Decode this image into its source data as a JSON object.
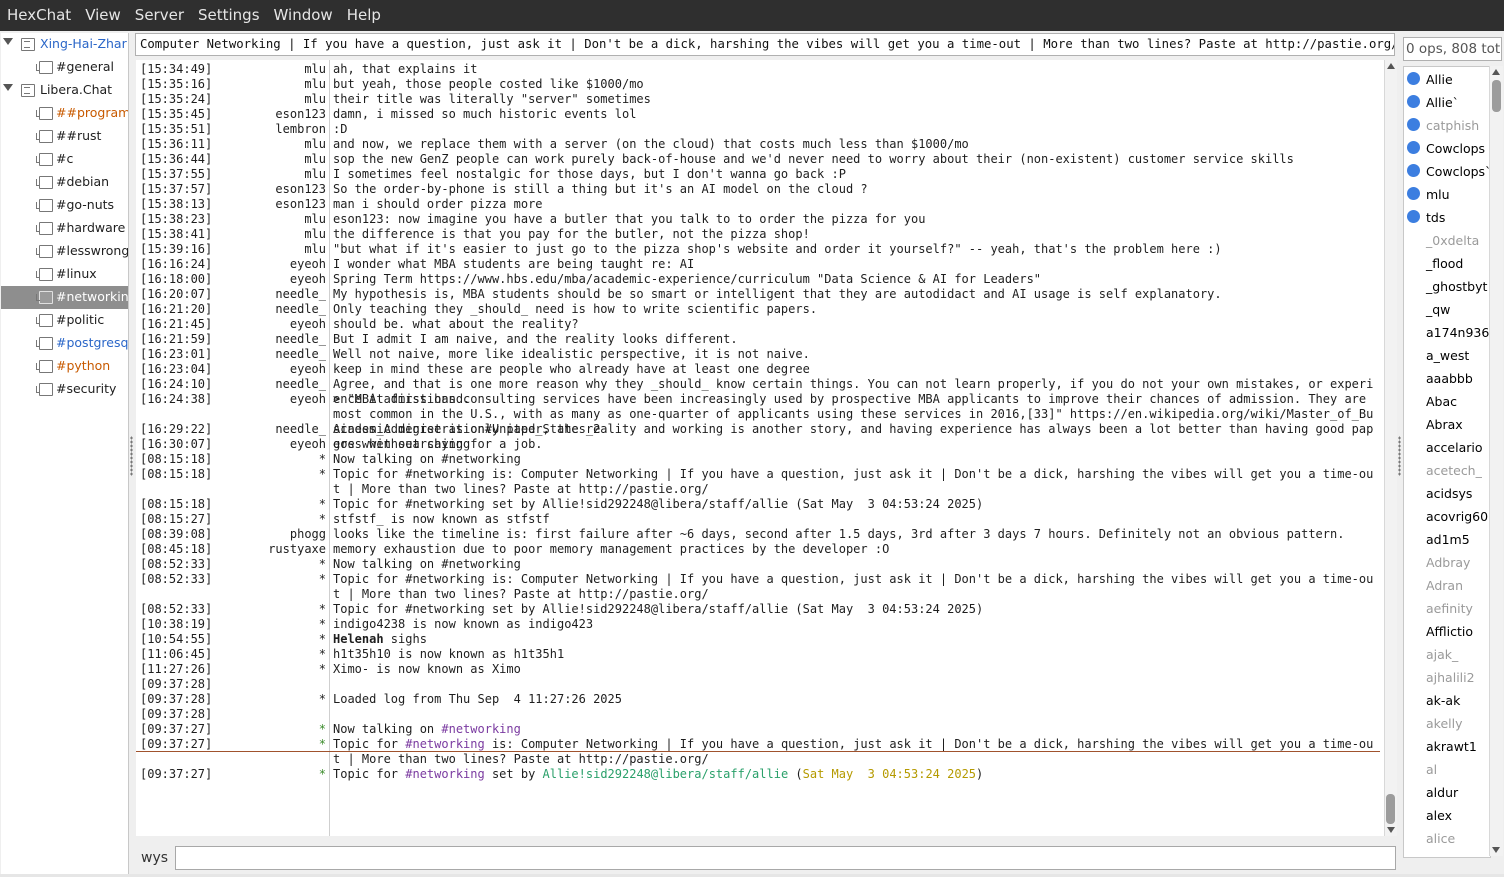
{
  "menu": [
    "HexChat",
    "View",
    "Server",
    "Settings",
    "Window",
    "Help"
  ],
  "tree": [
    {
      "label": "Xing-Hai-Zhar",
      "kind": "server",
      "style": "highlight"
    },
    {
      "label": "#general",
      "kind": "channel",
      "style": "normal"
    },
    {
      "label": "Libera.Chat",
      "kind": "server",
      "style": "normal"
    },
    {
      "label": "##programm",
      "kind": "channel",
      "style": "new-msg"
    },
    {
      "label": "##rust",
      "kind": "channel",
      "style": "normal"
    },
    {
      "label": "#c",
      "kind": "channel",
      "style": "normal"
    },
    {
      "label": "#debian",
      "kind": "channel",
      "style": "normal"
    },
    {
      "label": "#go-nuts",
      "kind": "channel",
      "style": "normal"
    },
    {
      "label": "#hardware",
      "kind": "channel",
      "style": "normal"
    },
    {
      "label": "#lesswrong",
      "kind": "channel",
      "style": "normal"
    },
    {
      "label": "#linux",
      "kind": "channel",
      "style": "normal"
    },
    {
      "label": "#networking",
      "kind": "channel",
      "style": "selected"
    },
    {
      "label": "#politic",
      "kind": "channel",
      "style": "normal"
    },
    {
      "label": "#postgresq",
      "kind": "channel",
      "style": "highlight"
    },
    {
      "label": "#python",
      "kind": "channel",
      "style": "new-msg"
    },
    {
      "label": "#security",
      "kind": "channel",
      "style": "normal"
    }
  ],
  "topic": "Computer Networking | If you have a question, just ask it | Don't be a dick, harshing the vibes will get you a time-out | More than two lines? Paste at http://pastie.org/",
  "chat": {
    "lines": [
      {
        "ts": "[15:34:49]",
        "nick": "mlu",
        "msg": "ah, that explains it"
      },
      {
        "ts": "[15:35:16]",
        "nick": "mlu",
        "msg": "but yeah, those people costed like $1000/mo"
      },
      {
        "ts": "[15:35:24]",
        "nick": "mlu",
        "msg": "their title was literally \"server\" sometimes"
      },
      {
        "ts": "[15:35:45]",
        "nick": "eson123",
        "msg": "damn, i missed so much historic events lol"
      },
      {
        "ts": "[15:35:51]",
        "nick": "lembron",
        "msg": ":D"
      },
      {
        "ts": "[15:36:11]",
        "nick": "mlu",
        "msg": "and now, we replace them with a server (on the cloud) that costs much less than $1000/mo"
      },
      {
        "ts": "[15:36:44]",
        "nick": "mlu",
        "msg": "sop the new GenZ people can work purely back-of-house and we'd never need to worry about their (non-existent) customer service skills"
      },
      {
        "ts": "[15:37:55]",
        "nick": "mlu",
        "msg": "I sometimes feel nostalgic for those days, but I don't wanna go back :P"
      },
      {
        "ts": "[15:37:57]",
        "nick": "eson123",
        "msg": "So the order-by-phone is still a thing but it's an AI model on the cloud ?"
      },
      {
        "ts": "[15:38:13]",
        "nick": "eson123",
        "msg": "man i should order pizza more"
      },
      {
        "ts": "[15:38:23]",
        "nick": "mlu",
        "msg": "eson123: now imagine you have a butler that you talk to to order the pizza for you"
      },
      {
        "ts": "[15:38:41]",
        "nick": "mlu",
        "msg": "the difference is that you pay for the butler, not the pizza shop!"
      },
      {
        "ts": "[15:39:16]",
        "nick": "mlu",
        "msg": "\"but what if it's easier to just go to the pizza shop's website and order it yourself?\" -- yeah, that's the problem here :)"
      },
      {
        "ts": "[16:16:24]",
        "nick": "eyeoh",
        "msg": "I wonder what MBA students are being taught re: AI"
      },
      {
        "ts": "[16:18:00]",
        "nick": "eyeoh",
        "msg": "Spring Term https://www.hbs.edu/mba/academic-experience/curriculum \"Data Science & AI for Leaders\""
      },
      {
        "ts": "[16:20:07]",
        "nick": "needle_",
        "msg": "My hypothesis is, MBA students should be so smart or intelligent that they are autodidact and AI usage is self explanatory."
      },
      {
        "ts": "[16:21:20]",
        "nick": "needle_",
        "msg": "Only teaching they _should_ need is how to write scientific papers."
      },
      {
        "ts": "[16:21:45]",
        "nick": "eyeoh",
        "msg": "should be. what about the reality?"
      },
      {
        "ts": "[16:21:59]",
        "nick": "needle_",
        "msg": "But I admit I am naive, and the reality looks different."
      },
      {
        "ts": "[16:23:01]",
        "nick": "needle_",
        "msg": "Well not naive, more like idealistic perspective, it is not naive."
      },
      {
        "ts": "[16:23:04]",
        "nick": "eyeoh",
        "msg": "keep in mind these are people who already have at least one degree"
      },
      {
        "ts": "[16:24:10]",
        "nick": "needle_",
        "msg": "Agree, and that is one more reason why they _should_ know certain things. You can not learn properly, if you do not your own mistakes, or experience it first hand."
      },
      {
        "ts": "[16:24:38]",
        "nick": "eyeoh",
        "msg": "> \"MBA admissions consulting services have been increasingly used by prospective MBA applicants to improve their chances of admission. They are most common in the U.S., with as many as one-quarter of applicants using these services in 2016,[33]\" https://en.wikipedia.org/wiki/Master_of_Business_Administration#United_States_2"
      },
      {
        "ts": "[16:29:22]",
        "nick": "needle_",
        "msg": "Academic degree is only paper, the reality and working is another story, and having experience has always been a lot better than having good papers when searching for a job."
      },
      {
        "ts": "[16:30:07]",
        "nick": "eyeoh",
        "msg": "goes without saying"
      },
      {
        "ts": "[08:15:18]",
        "nick": "*",
        "msg": "Now talking on #networking"
      },
      {
        "ts": "[08:15:18]",
        "nick": "*",
        "msg": "Topic for #networking is: Computer Networking | If you have a question, just ask it | Don't be a dick, harshing the vibes will get you a time-out | More than two lines? Paste at http://pastie.org/"
      },
      {
        "ts": "[08:15:18]",
        "nick": "*",
        "msg": "Topic for #networking set by Allie!sid292248@libera/staff/allie (Sat May  3 04:53:24 2025)"
      },
      {
        "ts": "[08:15:27]",
        "nick": "*",
        "msg": "stfstf_ is now known as stfstf"
      },
      {
        "ts": "[08:39:08]",
        "nick": "phogg",
        "msg": "looks like the timeline is: first failure after ~6 days, second after 1.5 days, 3rd after 3 days 7 hours. Definitely not an obvious pattern."
      },
      {
        "ts": "[08:45:18]",
        "nick": "rustyaxe",
        "msg": "memory exhaustion due to poor memory management practices by the developer :O"
      },
      {
        "ts": "[08:52:33]",
        "nick": "*",
        "msg": "Now talking on #networking"
      },
      {
        "ts": "[08:52:33]",
        "nick": "*",
        "msg": "Topic for #networking is: Computer Networking | If you have a question, just ask it | Don't be a dick, harshing the vibes will get you a time-out | More than two lines? Paste at http://pastie.org/"
      },
      {
        "ts": "[08:52:33]",
        "nick": "*",
        "msg": "Topic for #networking set by Allie!sid292248@libera/staff/allie (Sat May  3 04:53:24 2025)"
      },
      {
        "ts": "[10:38:19]",
        "nick": "*",
        "msg": "indigo4238 is now known as indigo423"
      },
      {
        "ts": "[10:54:55]",
        "nick": "*",
        "msg_bold": "Helenah",
        "msg": " sighs"
      },
      {
        "ts": "[11:06:45]",
        "nick": "*",
        "msg": "h1t35h10 is now known as h1t35h1"
      },
      {
        "ts": "[11:27:26]",
        "nick": "*",
        "msg": "Ximo- is now known as Ximo"
      },
      {
        "ts": "[09:37:28]",
        "nick": "",
        "msg": ""
      },
      {
        "ts": "[09:37:28]",
        "nick": "*",
        "msg": "Loaded log from Thu Sep  4 11:27:26 2025"
      },
      {
        "ts": "[09:37:28]",
        "nick": "",
        "msg": "",
        "new": true
      },
      {
        "ts": "[09:37:27]",
        "nick": "*",
        "new": true,
        "parts": [
          [
            "Now talking on ",
            ""
          ],
          [
            "#networking",
            "chan"
          ]
        ]
      },
      {
        "ts": "[09:37:27]",
        "nick": "*",
        "new": true,
        "parts": [
          [
            "Topic for ",
            ""
          ],
          [
            "#networking",
            "chan"
          ],
          [
            " is: Computer Networking | If you have a question, just ask it | Don't be a dick, harshing the vibes will get you a time-out | More than two lines? Paste at http://pastie.org/",
            ""
          ]
        ]
      },
      {
        "ts": "[09:37:27]",
        "nick": "*",
        "new": true,
        "parts": [
          [
            "Topic for ",
            ""
          ],
          [
            "#networking",
            "chan"
          ],
          [
            " set by ",
            ""
          ],
          [
            "Allie!sid292248@libera/staff/allie",
            "host"
          ],
          [
            " (",
            ""
          ],
          [
            "Sat May  3 04:53:24 2025",
            "date"
          ],
          [
            ")",
            ""
          ]
        ]
      }
    ]
  },
  "input": {
    "nick": "wys",
    "value": ""
  },
  "userlist": {
    "count": "0 ops, 808 total",
    "users": [
      {
        "name": "Allie",
        "status": "op"
      },
      {
        "name": "Allie`",
        "status": "op"
      },
      {
        "name": "catphish",
        "status": "op-away"
      },
      {
        "name": "Cowclops",
        "status": "op"
      },
      {
        "name": "Cowclops`",
        "status": "op"
      },
      {
        "name": "mlu",
        "status": "op"
      },
      {
        "name": "tds",
        "status": "op"
      },
      {
        "name": "_0xdelta",
        "status": "away"
      },
      {
        "name": "_flood",
        "status": "normal"
      },
      {
        "name": "_ghostbyt",
        "status": "normal"
      },
      {
        "name": "_qw",
        "status": "normal"
      },
      {
        "name": "a174n936",
        "status": "normal"
      },
      {
        "name": "a_west",
        "status": "normal"
      },
      {
        "name": "aaabbb",
        "status": "normal"
      },
      {
        "name": "Abac",
        "status": "normal"
      },
      {
        "name": "Abrax",
        "status": "normal"
      },
      {
        "name": "accelario",
        "status": "normal"
      },
      {
        "name": "acetech_",
        "status": "away"
      },
      {
        "name": "acidsys",
        "status": "normal"
      },
      {
        "name": "acovrig60",
        "status": "normal"
      },
      {
        "name": "ad1m5",
        "status": "normal"
      },
      {
        "name": "Adbray",
        "status": "away"
      },
      {
        "name": "Adran",
        "status": "away"
      },
      {
        "name": "aefinity",
        "status": "away"
      },
      {
        "name": "Afflictio",
        "status": "normal"
      },
      {
        "name": "ajak_",
        "status": "away"
      },
      {
        "name": "ajhalili2",
        "status": "away"
      },
      {
        "name": "ak-ak",
        "status": "normal"
      },
      {
        "name": "akelly",
        "status": "away"
      },
      {
        "name": "akrawt1",
        "status": "normal"
      },
      {
        "name": "al",
        "status": "away"
      },
      {
        "name": "aldur",
        "status": "normal"
      },
      {
        "name": "alex",
        "status": "normal"
      },
      {
        "name": "alice",
        "status": "away"
      }
    ]
  },
  "colors": {
    "menubar_bg": "#2f2f2f",
    "selected_bg": "#8e8e8e",
    "highlight": "#2a66c8",
    "new_msg": "#c85a00",
    "user_dot": "#3c7ee0",
    "channel_link": "#7a3aa0",
    "host": "#2aa06a",
    "date": "#b59a00",
    "marker_line": "#a0522d"
  }
}
